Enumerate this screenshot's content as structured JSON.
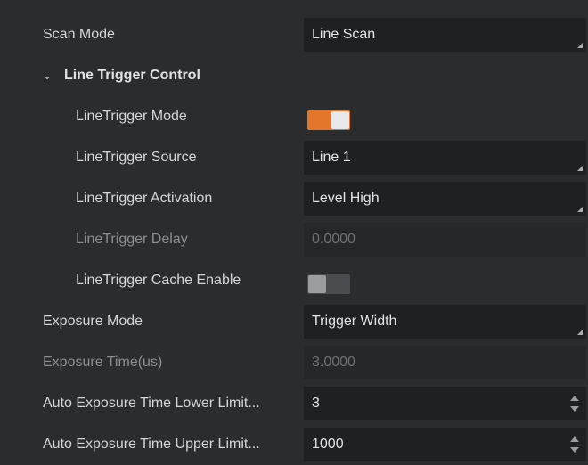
{
  "rows": {
    "scan_mode": {
      "label": "Scan Mode",
      "value": "Line Scan"
    },
    "line_trigger_group": {
      "label": "Line Trigger Control"
    },
    "line_trigger_mode": {
      "label": "LineTrigger Mode",
      "state": "on"
    },
    "line_trigger_source": {
      "label": "LineTrigger Source",
      "value": "Line 1"
    },
    "line_trigger_activation": {
      "label": "LineTrigger Activation",
      "value": "Level High"
    },
    "line_trigger_delay": {
      "label": "LineTrigger Delay",
      "value": "0.0000"
    },
    "line_trigger_cache_enable": {
      "label": "LineTrigger Cache Enable",
      "state": "off"
    },
    "exposure_mode": {
      "label": "Exposure Mode",
      "value": "Trigger Width"
    },
    "exposure_time": {
      "label": "Exposure Time(us)",
      "value": "3.0000"
    },
    "auto_exposure_lower": {
      "label": "Auto Exposure Time Lower Limit...",
      "value": "3"
    },
    "auto_exposure_upper": {
      "label": "Auto Exposure Time Upper Limit...",
      "value": "1000"
    }
  },
  "colors": {
    "background": "#2b2c2e",
    "field": "#1f2022",
    "toggle_on": "#e2762a",
    "toggle_off": "#4b4c50",
    "text": "#d6d6d8",
    "text_disabled": "#8d8e92"
  },
  "icons": {
    "group_expand": "chevron-down-icon",
    "dropdown": "dropdown-corner-icon",
    "spinner": "spinner-arrows-icon"
  }
}
